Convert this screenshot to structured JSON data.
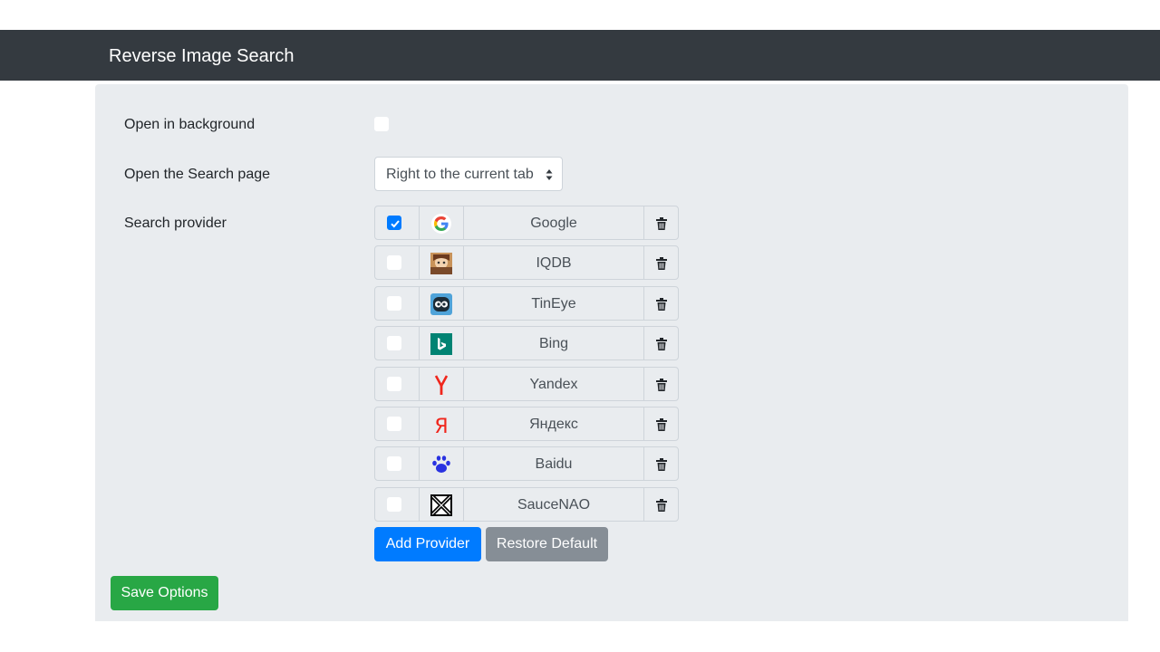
{
  "app": {
    "title": "Reverse Image Search"
  },
  "options": {
    "open_in_background": {
      "label": "Open in background",
      "checked": false
    },
    "open_search_page": {
      "label": "Open the Search page",
      "selected": "Right to the current tab"
    },
    "search_provider": {
      "label": "Search provider"
    }
  },
  "providers": [
    {
      "name": "Google",
      "enabled": true,
      "icon": "google-icon"
    },
    {
      "name": "IQDB",
      "enabled": false,
      "icon": "iqdb-icon"
    },
    {
      "name": "TinEye",
      "enabled": false,
      "icon": "tineye-icon"
    },
    {
      "name": "Bing",
      "enabled": false,
      "icon": "bing-icon"
    },
    {
      "name": "Yandex",
      "enabled": false,
      "icon": "yandex-icon"
    },
    {
      "name": "Яндекс",
      "enabled": false,
      "icon": "yandex-ru-icon"
    },
    {
      "name": "Baidu",
      "enabled": false,
      "icon": "baidu-icon"
    },
    {
      "name": "SauceNAO",
      "enabled": false,
      "icon": "saucenao-icon"
    }
  ],
  "buttons": {
    "add_provider": "Add Provider",
    "restore_default": "Restore Default",
    "save_options": "Save Options"
  },
  "colors": {
    "navbar": "#343a40",
    "panel": "#e9ecef",
    "primary": "#007bff",
    "secondary": "#868e96",
    "success": "#28a745"
  }
}
